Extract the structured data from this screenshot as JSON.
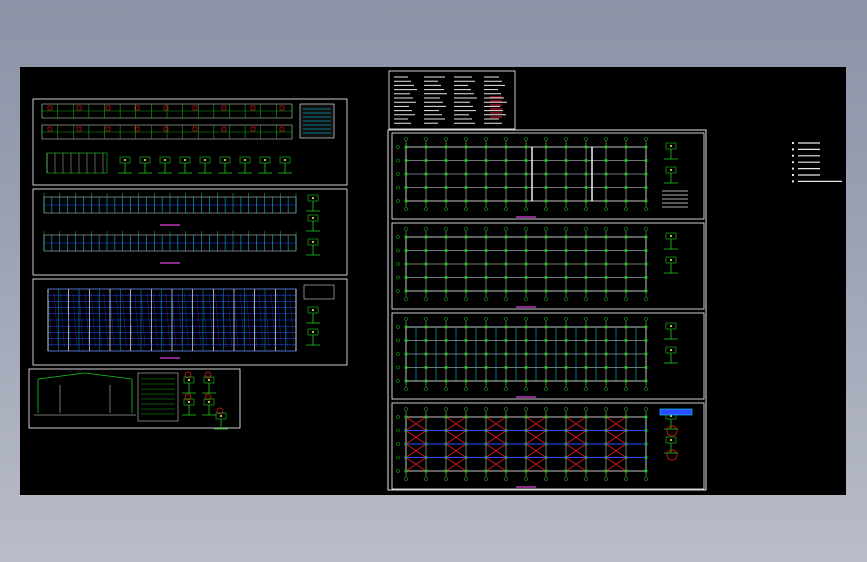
{
  "viewer": {
    "background_color": "#000000",
    "desktop_gradient": [
      "#8c93a6",
      "#b9bdc9"
    ],
    "frame_color": "#ffffff",
    "line_color": "#19c819",
    "grid_color": "#e8e8e8",
    "accent_colors": {
      "red": "#e01818",
      "cyan": "#00e0ff",
      "blue": "#2a4bff",
      "magenta": "#e040e0",
      "yellow": "#ffff40"
    }
  },
  "sheets": [
    {
      "id": "elevation-sheet",
      "content": "elevations-and-details"
    },
    {
      "id": "section-sheet",
      "content": "blue-sections"
    },
    {
      "id": "structural-plan-sheet",
      "content": "dense-blue-plan"
    },
    {
      "id": "detail-sheet-small",
      "content": "frame-details"
    },
    {
      "id": "notes-sheet",
      "content": "text-notes"
    },
    {
      "id": "plan-sheet-1",
      "content": "column-grid-plan"
    },
    {
      "id": "plan-sheet-2",
      "content": "column-grid-plan"
    },
    {
      "id": "plan-sheet-3",
      "content": "cyan-grid-plan"
    },
    {
      "id": "plan-sheet-4",
      "content": "bracing-plan"
    }
  ],
  "legend": {
    "marker_color": "#e8e8e8",
    "item_count": 7
  }
}
